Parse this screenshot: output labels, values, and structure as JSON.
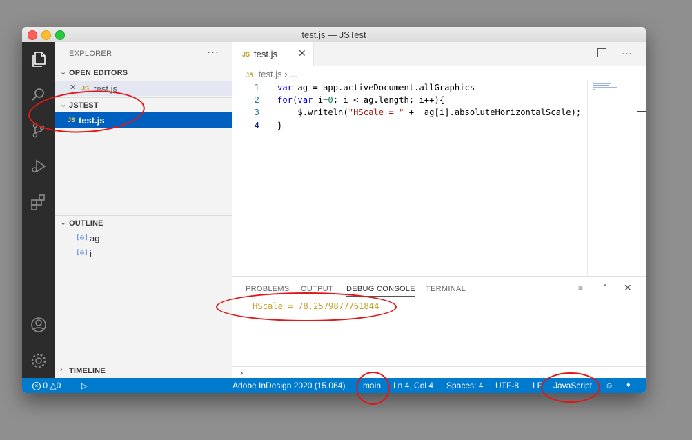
{
  "window": {
    "title": "test.js — JSTest"
  },
  "sidebar": {
    "header": "EXPLORER",
    "more": "···",
    "open_editors": {
      "label": "OPEN EDITORS",
      "item": {
        "close": "✕",
        "badge": "JS",
        "name": "test.js"
      }
    },
    "project": {
      "label": "JSTEST",
      "file": {
        "badge": "JS",
        "name": "test.js"
      }
    },
    "outline": {
      "label": "OUTLINE",
      "items": [
        {
          "icon": "[◎]",
          "name": "ag"
        },
        {
          "icon": "[◎]",
          "name": "i"
        }
      ]
    },
    "timeline": {
      "label": "TIMELINE"
    }
  },
  "editor": {
    "tab": {
      "badge": "JS",
      "name": "test.js",
      "close": "✕"
    },
    "breadcrumb": {
      "badge": "JS",
      "file": "test.js",
      "sep": "›",
      "more": "..."
    },
    "lines": [
      {
        "num": "1",
        "parts": [
          {
            "t": "var",
            "k": "kw"
          },
          {
            "t": " ag = app.activeDocument.allGraphics",
            "k": ""
          }
        ]
      },
      {
        "num": "2",
        "parts": [
          {
            "t": "for",
            "k": "kw"
          },
          {
            "t": "(",
            "k": ""
          },
          {
            "t": "var",
            "k": "kw"
          },
          {
            "t": " i=",
            "k": ""
          },
          {
            "t": "0",
            "k": "num"
          },
          {
            "t": "; i < ag.length; i++){",
            "k": ""
          }
        ]
      },
      {
        "num": "3",
        "parts": [
          {
            "t": "    $.writeln(",
            "k": ""
          },
          {
            "t": "\"HScale = \"",
            "k": "str"
          },
          {
            "t": " +  ag[i].absoluteHorizontalScale);",
            "k": ""
          }
        ]
      },
      {
        "num": "4",
        "parts": [
          {
            "t": "}",
            "k": ""
          }
        ]
      }
    ]
  },
  "panel": {
    "tabs": [
      "PROBLEMS",
      "OUTPUT",
      "DEBUG CONSOLE",
      "TERMINAL"
    ],
    "active_tab": "DEBUG CONSOLE",
    "output": "HScale = 78.2579877761844",
    "prompt": "›"
  },
  "status": {
    "errors": "0",
    "warnings": "0",
    "host": "Adobe InDesign 2020 (15.064)",
    "branch": "main",
    "position": "Ln 4, Col 4",
    "spaces": "Spaces: 4",
    "encoding": "UTF-8",
    "eol": "LF",
    "language": "JavaScript"
  },
  "colors": {
    "accent": "#007acc",
    "annotation": "#e21616",
    "activity_bar": "#2c2c2c"
  }
}
